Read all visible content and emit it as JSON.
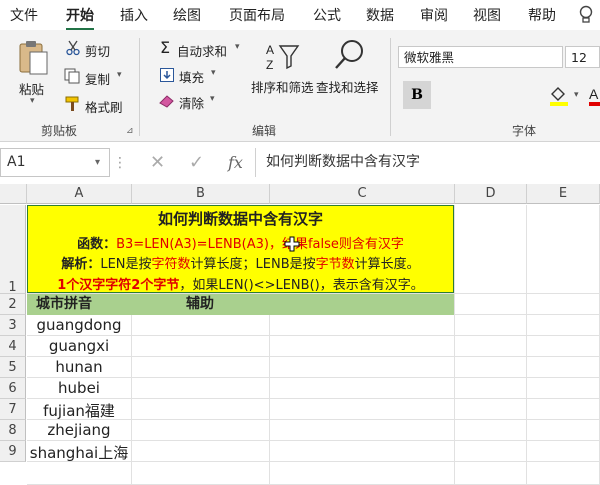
{
  "tabs": [
    "文件",
    "开始",
    "插入",
    "绘图",
    "页面布局",
    "公式",
    "数据",
    "审阅",
    "视图",
    "帮助"
  ],
  "ribbon": {
    "clipboard": {
      "paste": "粘贴",
      "cut": "剪切",
      "copy": "复制",
      "format_painter": "格式刷",
      "label": "剪贴板"
    },
    "editing": {
      "autosum": "自动求和",
      "fill": "填充",
      "clear": "清除",
      "sort_filter": "排序和筛选",
      "find_select": "查找和选择",
      "label": "编辑"
    },
    "font": {
      "name": "微软雅黑",
      "size": "12",
      "bold": "B",
      "label": "字体"
    }
  },
  "formula_bar": {
    "name_box": "A1",
    "content": "如何判断数据中含有汉字"
  },
  "columns": [
    "A",
    "B",
    "C",
    "D",
    "E"
  ],
  "rows": [
    "1",
    "2",
    "3",
    "4",
    "5",
    "6",
    "7",
    "8",
    "9"
  ],
  "row1": {
    "title": "如何判断数据中含有汉字",
    "line2_label": "函数：",
    "line2_formula": "B3=LEN(A3)=LENB(A3)，结果false则含有汉字",
    "line3_label": "解析：",
    "line3_a": "LEN是按",
    "line3_b": "字符数",
    "line3_c": "计算长度；LENB是按",
    "line3_d": "字节数",
    "line3_e": "计算长度。",
    "line4_a": "1个汉字字符2个字节",
    "line4_b": "，如果LEN()<>LENB()，表示含有汉字。"
  },
  "header_row": {
    "a": "城市拼音",
    "b": "辅助"
  },
  "cities": [
    "guangdong",
    "guangxi",
    "hunan",
    "hubei",
    "fujian福建",
    "zhejiang",
    "shanghai上海"
  ],
  "colors": {
    "accent": "#217346",
    "yellow": "#ffff00",
    "green_header": "#a9d08e",
    "red": "#e00000"
  }
}
